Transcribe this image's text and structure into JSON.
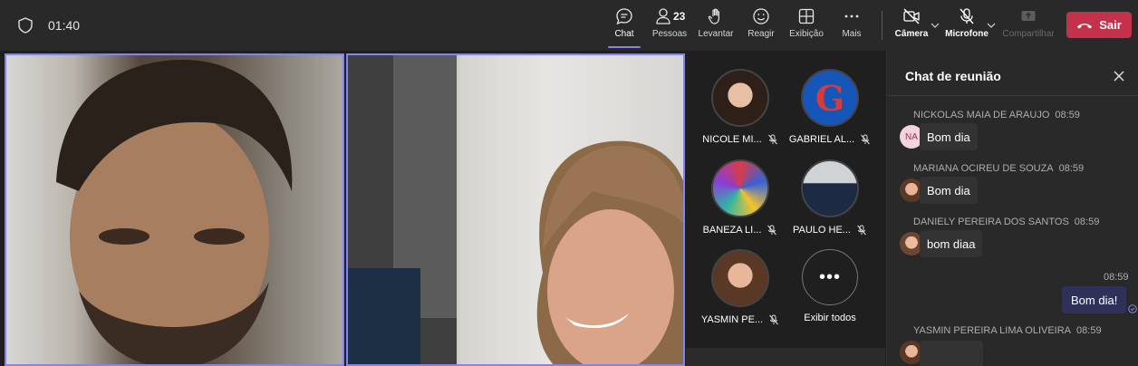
{
  "meeting": {
    "timer": "01:40"
  },
  "toolbar": {
    "chat_label": "Chat",
    "people_label": "Pessoas",
    "people_count": "23",
    "raise_label": "Levantar",
    "react_label": "Reagir",
    "view_label": "Exibição",
    "more_label": "Mais",
    "camera_label": "Câmera",
    "mic_label": "Microfone",
    "share_label": "Compartilhar",
    "leave_label": "Sair"
  },
  "participants": [
    {
      "name": "NICOLE MI..."
    },
    {
      "name": "GABRIEL AL..."
    },
    {
      "name": "BANEZA LI..."
    },
    {
      "name": "PAULO HE..."
    },
    {
      "name": "YASMIN PE..."
    }
  ],
  "show_all_label": "Exibir todos",
  "chat": {
    "title": "Chat de reunião",
    "messages": [
      {
        "sender": "NICKOLAS MAIA DE ARAUJO",
        "time": "08:59",
        "text": "Bom dia",
        "initials": "NA"
      },
      {
        "sender": "MARIANA OCIREU DE SOUZA",
        "time": "08:59",
        "text": "Bom dia"
      },
      {
        "sender": "DANIELY PEREIRA DOS SANTOS",
        "time": "08:59",
        "text": "bom diaa"
      },
      {
        "sender": "YASMIN PEREIRA LIMA OLIVEIRA",
        "time": "08:59",
        "text": ""
      }
    ],
    "own_message": {
      "time": "08:59",
      "text": "Bom dia!"
    }
  },
  "colors": {
    "accent": "#7f85f5",
    "leave": "#c4314b",
    "background": "#1f1f1f",
    "panel": "#292929"
  },
  "icons": [
    "shield-icon",
    "chat-icon",
    "people-icon",
    "hand-icon",
    "smile-icon",
    "view-icon",
    "more-icon",
    "camera-off-icon",
    "mic-off-icon",
    "share-icon",
    "phone-icon",
    "close-icon",
    "muted-mic-icon",
    "read-receipt-icon"
  ]
}
